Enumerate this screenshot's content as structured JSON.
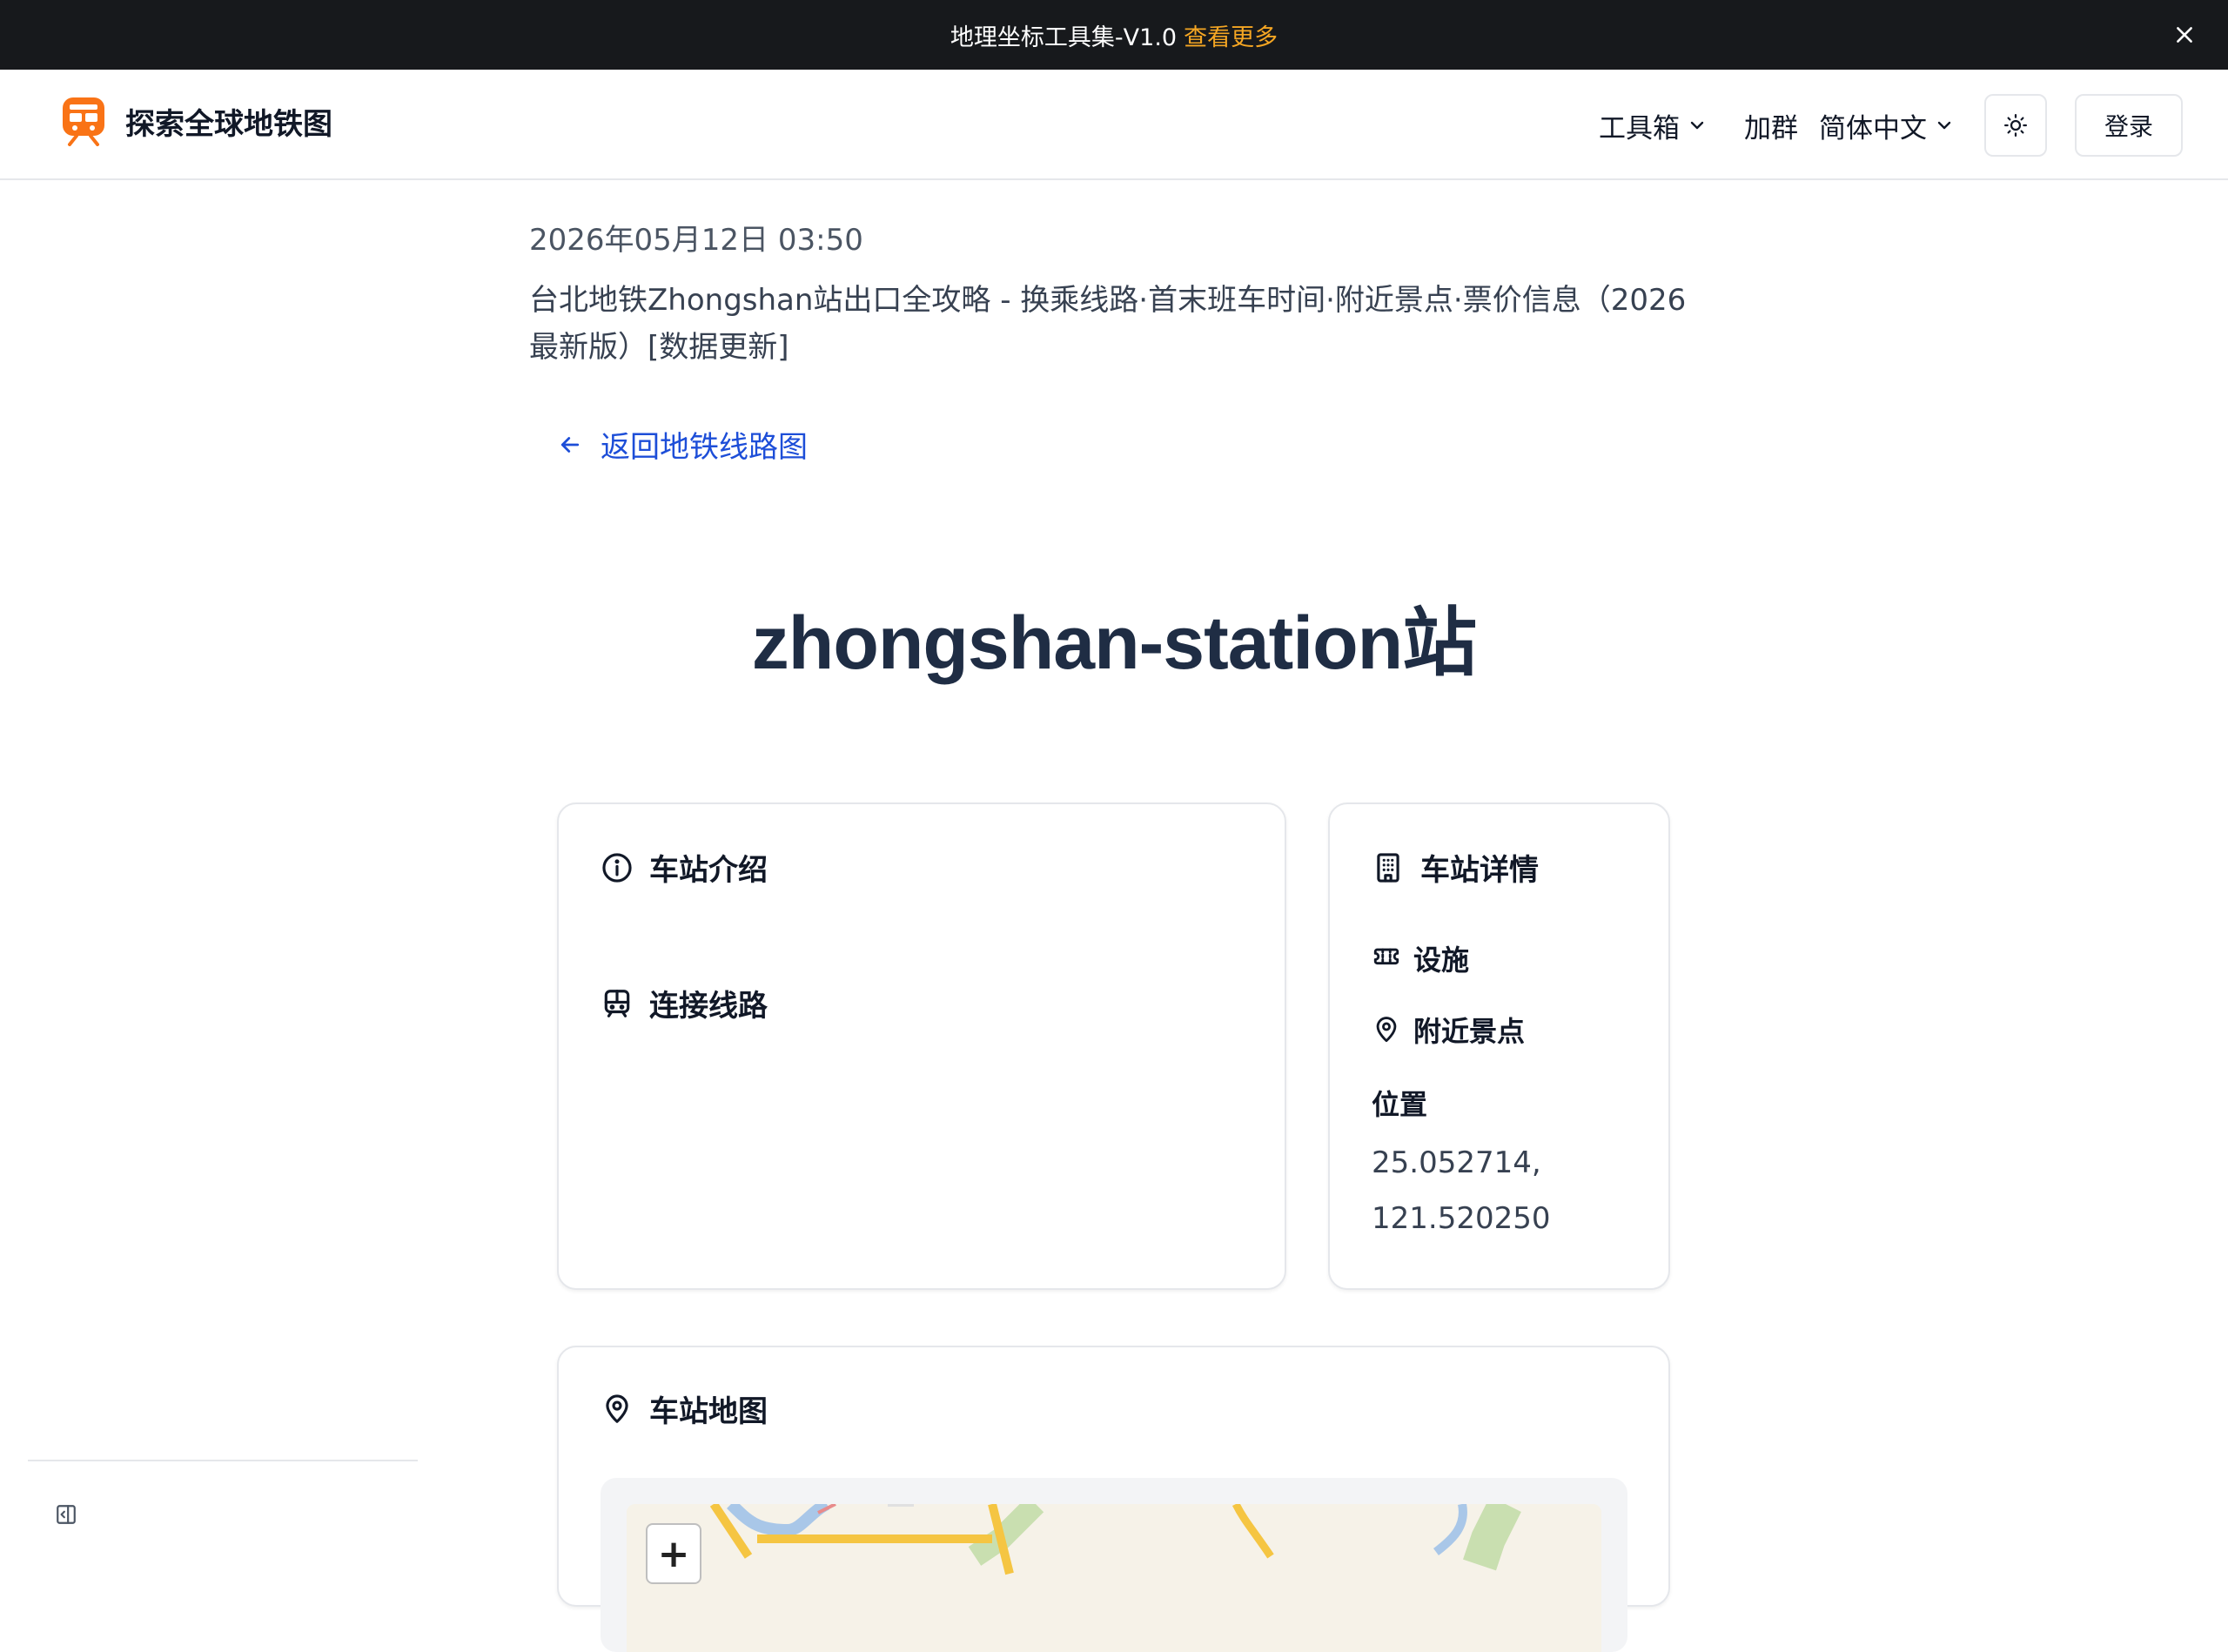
{
  "announcement": {
    "text": "地理坐标工具集-V1.0",
    "link_label": "查看更多"
  },
  "brand": {
    "name": "探索全球地铁图"
  },
  "nav": {
    "toolbox_label": "工具箱",
    "join_group_label": "加群",
    "language_label": "简体中文",
    "login_label": "登录"
  },
  "article": {
    "date": "2026年05月12日 03:50",
    "image_alt": "台北地铁Zhongshan站出口全攻略 - 换乘线路·首末班车时间·附近景点·票价信息（2026最新版）[数据更新]",
    "back_label": "返回地铁线路图"
  },
  "station": {
    "title": "zhongshan-station站",
    "intro_heading": "车站介绍",
    "lines_heading": "连接线路",
    "details_heading": "车站详情",
    "facilities_heading": "设施",
    "nearby_heading": "附近景点",
    "location_heading": "位置",
    "lat": "25.052714,",
    "lng": "121.520250",
    "map_heading": "车站地图"
  },
  "map": {
    "zoom_in_label": "+"
  },
  "colors": {
    "accent_orange": "#f5a623",
    "link_blue": "#1d4ed8",
    "logo_orange": "#f97316",
    "announce_bg": "#17191c"
  },
  "icons": {
    "close": "close-icon",
    "logo": "train-logo-icon",
    "chevron": "chevron-down-icon",
    "theme": "sun-icon",
    "back": "arrow-left-icon",
    "info": "info-icon",
    "train": "train-icon",
    "building": "building-icon",
    "ticket": "ticket-icon",
    "pin": "map-pin-icon",
    "sidebar": "sidebar-toggle-icon"
  }
}
